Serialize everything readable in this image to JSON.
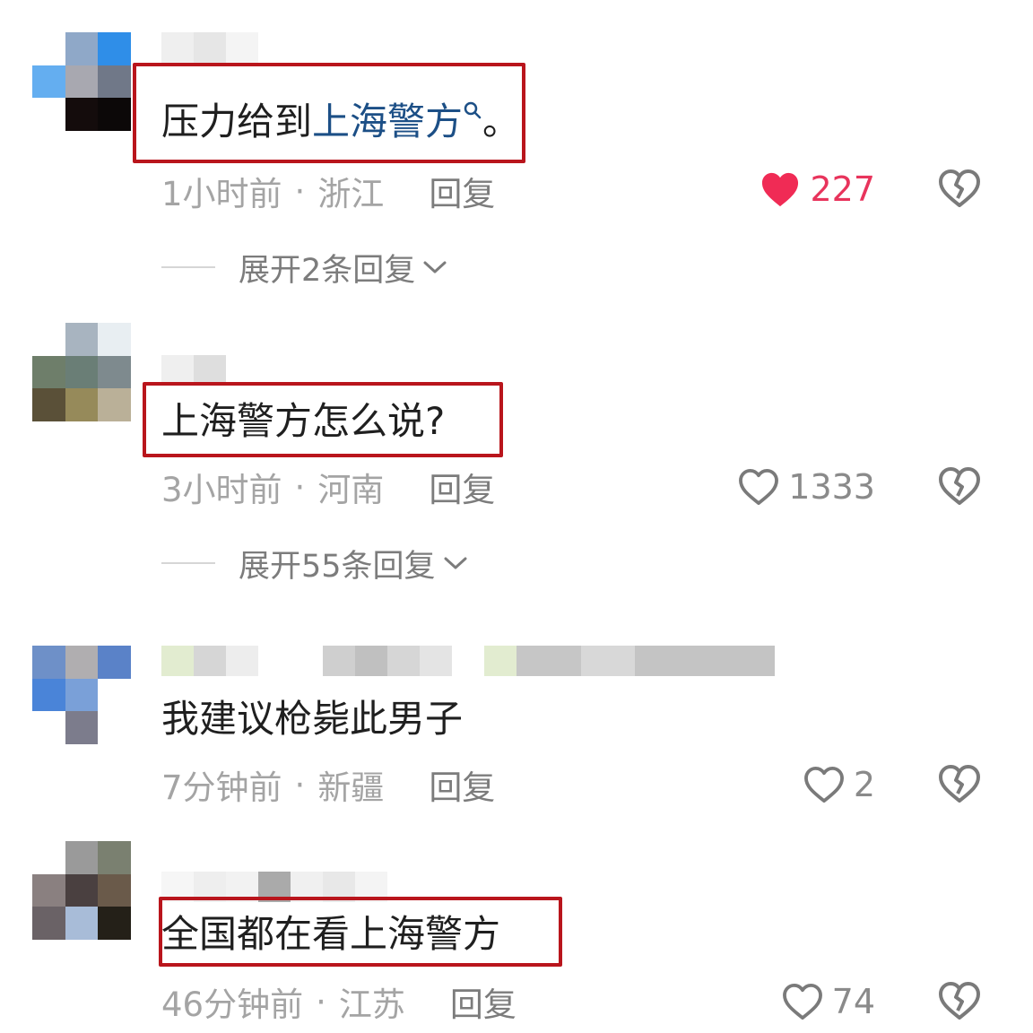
{
  "comments": [
    {
      "text_plain": "压力给到",
      "text_link": "上海警方",
      "text_suffix": "。",
      "time": "1小时前",
      "region": "浙江",
      "reply_label": "回复",
      "likes": "227",
      "liked": true,
      "expand_label": "展开2条回复"
    },
    {
      "text": "上海警方怎么说?",
      "time": "3小时前",
      "region": "河南",
      "reply_label": "回复",
      "likes": "1333",
      "liked": false,
      "expand_label": "展开55条回复"
    },
    {
      "text": "我建议枪毙此男子",
      "time": "7分钟前",
      "region": "新疆",
      "reply_label": "回复",
      "likes": "2",
      "liked": false
    },
    {
      "text": "全国都在看上海警方",
      "time": "46分钟前",
      "region": "江苏",
      "reply_label": "回复",
      "likes": "74",
      "liked": false
    }
  ],
  "meta_separator": "·",
  "icons": {
    "like": "heart-icon",
    "dislike": "broken-heart-icon",
    "search": "search-icon",
    "expand": "chevron-down-icon"
  },
  "colors": {
    "highlight_box": "#b9151c",
    "liked": "#e8345c",
    "link": "#1c4f86"
  }
}
